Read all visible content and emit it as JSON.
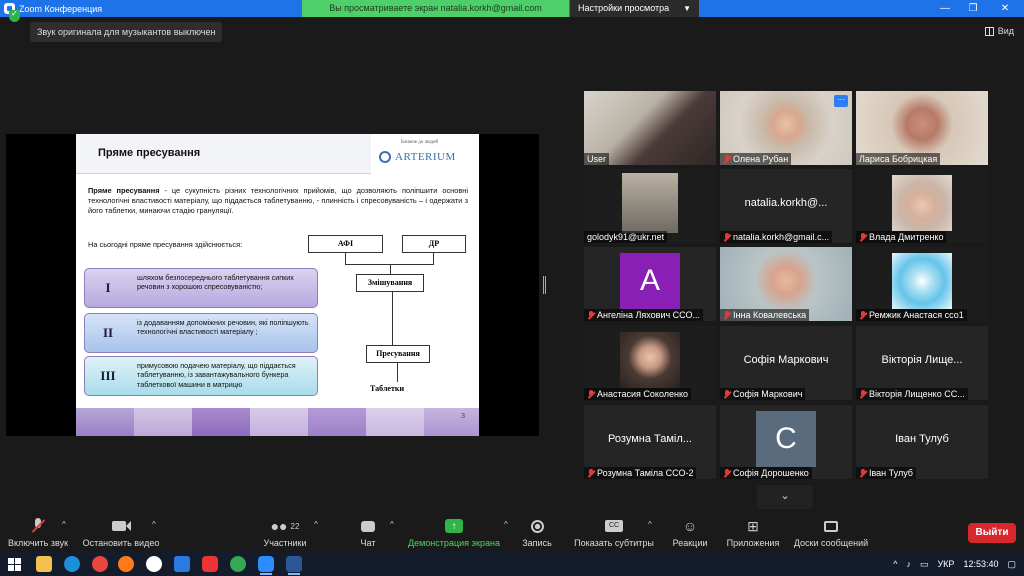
{
  "window": {
    "title": "Zoom Конференция",
    "share_banner": "Вы просматриваете экран natalia.korkh@gmail.com",
    "view_settings": "Настройки просмотра",
    "minimize": "—",
    "maximize": "❐",
    "close": "✕"
  },
  "topbar": {
    "notice": "Звук оригинала для музыкантов выключен",
    "view_label": "Вид"
  },
  "slide": {
    "title": "Пряме пресування",
    "logo_tagline": "Ближче до людей",
    "logo_text": "ARTERIUM",
    "def_bold": "Пряме пресування",
    "def_rest": " - це сукупність різних технологічних прийомів, що дозволяють поліпшити основні технологічні властивості матеріалу, що піддається таблетуванню, - плинність і спресовуваність – і одержати з його таблетки, минаючи стадію грануляції.",
    "subtitle": "На сьогодні пряме пресування здійснюється:",
    "methods": [
      {
        "num": "I",
        "text": "шляхом безпосереднього таблетування сипких речовин з хорошою спресовуваністю;"
      },
      {
        "num": "II",
        "text": "із додаванням допоміжних речовин, які поліпшують технологічні властивості матеріалу ;"
      },
      {
        "num": "III",
        "text": "примусовою подачею матеріалу, що піддається таблетуванню, із завантажувального бункера таблеткової машини в матрицю"
      }
    ],
    "flow": {
      "afi": "АФІ",
      "dr": "ДР",
      "mix": "Змішування",
      "press": "Пресування",
      "tablets": "Таблетки"
    },
    "page": "3"
  },
  "participants": [
    {
      "name": "User",
      "muted": false,
      "video": true
    },
    {
      "name": "Олена Рубан",
      "muted": true,
      "video": true
    },
    {
      "name": "Лариса Бобрицкая",
      "muted": false,
      "video": true
    },
    {
      "name": "golodyk91@ukr.net",
      "muted": false,
      "video": true,
      "selected": true
    },
    {
      "name": "natalia.korkh@gmail.c...",
      "muted": true,
      "video": false,
      "big": "natalia.korkh@..."
    },
    {
      "name": "Влада Дмитренко",
      "muted": true,
      "video": true
    },
    {
      "name": "Ангеліна Ляхович ССО...",
      "muted": true,
      "video": false,
      "avatar": "A",
      "avatar_color": "#8a1fb5"
    },
    {
      "name": "Інна Ковалевська",
      "muted": true,
      "video": true
    },
    {
      "name": "Ремжик Анастася ссо1",
      "muted": true,
      "video": true
    },
    {
      "name": "Анастасия Соколенко",
      "muted": true,
      "video": true
    },
    {
      "name": "Софія Маркович",
      "muted": true,
      "video": false,
      "big": "Софія Маркович"
    },
    {
      "name": "Вікторія Лищенко СС...",
      "muted": true,
      "video": false,
      "big": "Вікторія Лище..."
    },
    {
      "name": "Розумна Тамiла ССО-2",
      "muted": true,
      "video": false,
      "big": "Розумна Таміл..."
    },
    {
      "name": "Софія Дорошенко",
      "muted": true,
      "video": false,
      "avatar": "C",
      "avatar_color": "#5a6b7d"
    },
    {
      "name": "Іван Тулуб",
      "muted": true,
      "video": false,
      "big": "Іван Тулуб"
    }
  ],
  "scroll_down": "⌄",
  "tile_more": "···",
  "toolbar": {
    "unmute": "Включить звук",
    "start_video": "Остановить видео",
    "participants": "Участники",
    "participants_count": "22",
    "chat": "Чат",
    "share": "Демонстрация экрана",
    "record": "Запись",
    "captions": "Показать субтитры",
    "reactions": "Реакции",
    "apps": "Приложения",
    "whiteboards": "Доски сообщений",
    "leave": "Выйти",
    "chevron": "^"
  },
  "taskbar": {
    "lang": "УКР",
    "time": "12:53:40",
    "tray_arrow": "^"
  },
  "colors": {
    "zoom_blue": "#1e73e8",
    "share_green": "#4fcf6a",
    "leave_red": "#d6282d",
    "selected_outline": "#d8e43f"
  }
}
